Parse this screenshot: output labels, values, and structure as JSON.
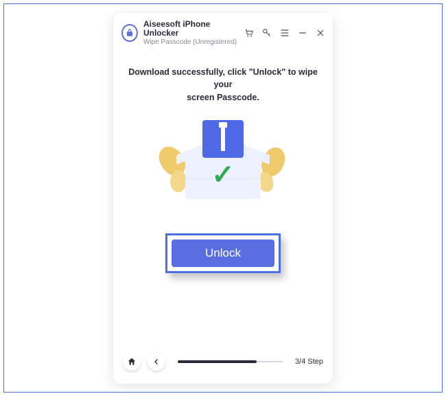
{
  "header": {
    "title": "Aiseesoft iPhone Unlocker",
    "subtitle": "Wipe Passcode  (Unregistered)"
  },
  "body": {
    "instruction_line1": "Download successfully, click \"Unlock\" to wipe your",
    "instruction_line2": "screen Passcode.",
    "unlock_label": "Unlock"
  },
  "footer": {
    "step_label": "3/4 Step",
    "progress_percent": 75
  },
  "icons": {
    "logo": "lock-icon",
    "cart": "cart-icon",
    "key": "key-icon",
    "menu": "menu-icon",
    "minimize": "minimize-icon",
    "close": "close-icon",
    "home": "home-icon",
    "back": "back-icon",
    "checkmark": "checkmark-icon"
  },
  "colors": {
    "accent": "#5b6ee1",
    "frame": "#4a6fe0",
    "success": "#34a853"
  }
}
